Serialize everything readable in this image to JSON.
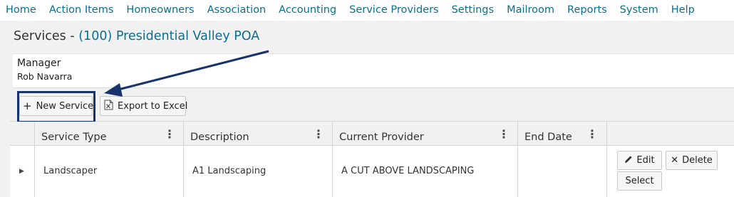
{
  "nav": {
    "items": [
      "Home",
      "Action Items",
      "Homeowners",
      "Association",
      "Accounting",
      "Service Providers",
      "Settings",
      "Mailroom",
      "Reports",
      "System",
      "Help"
    ]
  },
  "page": {
    "title_prefix": "Services - ",
    "association": "(100) Presidential Valley POA"
  },
  "manager": {
    "label": "Manager",
    "name": "Rob Navarra"
  },
  "toolbar": {
    "new_service_label": "New Service",
    "new_service_icon": "plus-icon",
    "export_label": "Export to Excel",
    "export_icon": "excel-icon"
  },
  "grid": {
    "columns": [
      "Service Type",
      "Description",
      "Current Provider",
      "End Date"
    ],
    "rows": [
      {
        "service_type": "Landscaper",
        "description": "A1 Landscaping",
        "current_provider": "A CUT ABOVE LANDSCAPING",
        "end_date": ""
      }
    ],
    "row_actions": {
      "edit": "Edit",
      "delete": "Delete",
      "select": "Select"
    }
  },
  "colors": {
    "nav_link": "#0b6f8f",
    "annotation": "#17336b",
    "panel_bg": "#f1f1f1"
  }
}
